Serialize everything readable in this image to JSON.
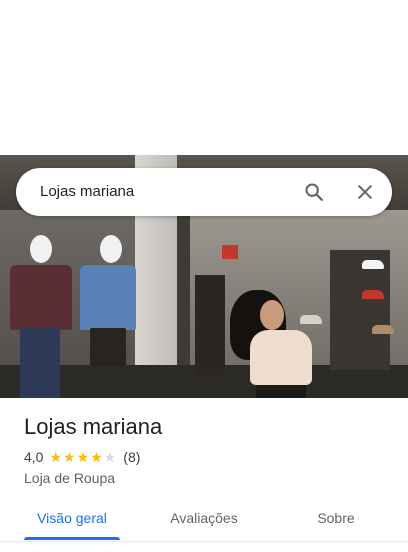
{
  "search": {
    "query": "Lojas mariana",
    "search_icon": "search-icon",
    "close_icon": "close-icon"
  },
  "hero_photo": {
    "description_icon": "storefront-photo"
  },
  "place": {
    "name": "Lojas mariana",
    "rating": "4,0",
    "rating_value": 4.0,
    "stars_max": 5,
    "review_count": "(8)",
    "category": "Loja de Roupa"
  },
  "tabs": [
    {
      "label": "Visão geral",
      "active": true
    },
    {
      "label": "Avaliações",
      "active": false
    },
    {
      "label": "Sobre",
      "active": false
    }
  ],
  "colors": {
    "accent": "#1a73e8",
    "star": "#fbbc04",
    "star_empty": "#dadce0",
    "text_primary": "#202124",
    "text_secondary": "#5f6368"
  }
}
